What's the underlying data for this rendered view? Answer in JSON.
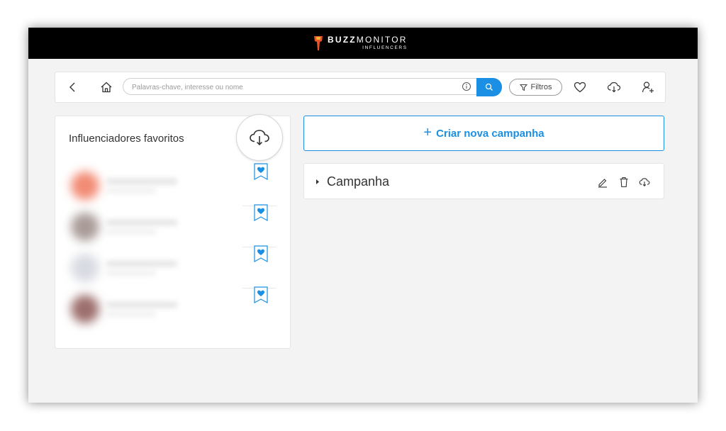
{
  "header": {
    "brand_bold": "BUZZ",
    "brand_light": "MONITOR",
    "brand_sub": "INFLUENCERS"
  },
  "toolbar": {
    "back_icon": "chevron-left-icon",
    "home_icon": "home-icon",
    "search_placeholder": "Palavras-chave, interesse ou nome",
    "search_value": "",
    "info_icon": "info-icon",
    "search_icon": "search-icon",
    "filter_label": "Filtros",
    "filter_icon": "funnel-icon",
    "favorites_icon": "heart-icon",
    "download_icon": "cloud-download-icon",
    "user_add_icon": "user-add-icon"
  },
  "favorites": {
    "title": "Influenciadores favoritos",
    "download_icon": "cloud-download-icon",
    "items": [
      {
        "avatar_color": "#f28b74",
        "name": "",
        "handle": ""
      },
      {
        "avatar_color": "#a99c98",
        "name": "",
        "handle": ""
      },
      {
        "avatar_color": "#d9dbe2",
        "name": "",
        "handle": ""
      },
      {
        "avatar_color": "#9c6f6d",
        "name": "",
        "handle": ""
      }
    ]
  },
  "campaigns": {
    "create_label": "Criar nova campanha",
    "items": [
      {
        "name": "Campanha"
      }
    ]
  },
  "colors": {
    "accent": "#1a8fe3",
    "topbar": "#000000",
    "background": "#f3f3f3"
  }
}
